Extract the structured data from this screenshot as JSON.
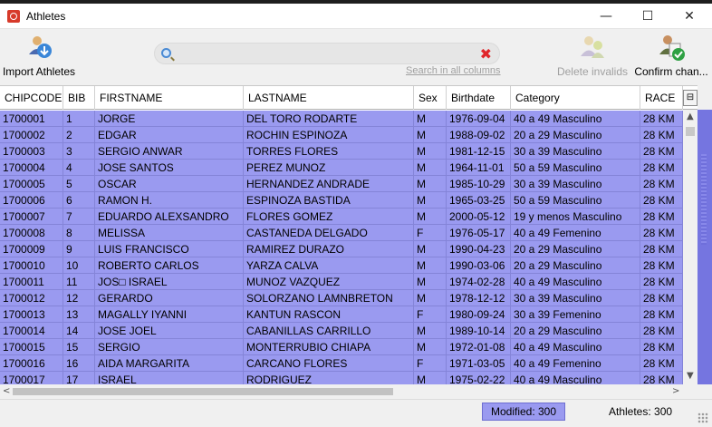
{
  "window": {
    "title": "Athletes",
    "minimize_glyph": "—",
    "maximize_glyph": "☐",
    "close_glyph": "✕"
  },
  "toolbar": {
    "import_label": "Import Athletes",
    "import_icon": "import-athletes-icon",
    "delete_invalids_label": "Delete invalids",
    "delete_invalids_icon": "delete-invalids-icon",
    "confirm_label": "Confirm chan...",
    "confirm_icon": "confirm-changes-icon"
  },
  "search": {
    "value": "",
    "search_icon": "search-icon",
    "clear_icon": "clear-icon",
    "clear_glyph": "✖",
    "scope_link": "Search in all columns"
  },
  "table": {
    "columns": [
      "CHIPCODE",
      "BIB",
      "FIRSTNAME",
      "LASTNAME",
      "Sex",
      "Birthdate",
      "Category",
      "RACE"
    ],
    "corner_glyph": "⊟",
    "rows": [
      [
        "1700001",
        "1",
        "JORGE",
        "DEL TORO RODARTE",
        "M",
        "1976-09-04",
        "40 a 49  Masculino",
        "28 KM"
      ],
      [
        "1700002",
        "2",
        "EDGAR",
        "ROCHIN ESPINOZA",
        "M",
        "1988-09-02",
        "20 a 29  Masculino",
        "28 KM"
      ],
      [
        "1700003",
        "3",
        "SERGIO ANWAR",
        "TORRES FLORES",
        "M",
        "1981-12-15",
        "30 a 39  Masculino",
        "28 KM"
      ],
      [
        "1700004",
        "4",
        "JOSE SANTOS",
        "PEREZ MUNOZ",
        "M",
        "1964-11-01",
        "50 a 59  Masculino",
        "28 KM"
      ],
      [
        "1700005",
        "5",
        "OSCAR",
        "HERNANDEZ ANDRADE",
        "M",
        "1985-10-29",
        "30 a 39  Masculino",
        "28 KM"
      ],
      [
        "1700006",
        "6",
        "RAMON H.",
        "ESPINOZA BASTIDA",
        "M",
        "1965-03-25",
        "50 a 59  Masculino",
        "28 KM"
      ],
      [
        "1700007",
        "7",
        "EDUARDO ALEXSANDRO",
        "FLORES GOMEZ",
        "M",
        "2000-05-12",
        "19  y menos Masculino",
        "28 KM"
      ],
      [
        "1700008",
        "8",
        "MELISSA",
        "CASTANEDA DELGADO",
        "F",
        "1976-05-17",
        "40 a 49  Femenino",
        "28 KM"
      ],
      [
        "1700009",
        "9",
        "LUIS FRANCISCO",
        "RAMIREZ DURAZO",
        "M",
        "1990-04-23",
        "20 a 29  Masculino",
        "28 KM"
      ],
      [
        "1700010",
        "10",
        "ROBERTO CARLOS",
        "YARZA CALVA",
        "M",
        "1990-03-06",
        "20 a 29  Masculino",
        "28 KM"
      ],
      [
        "1700011",
        "11",
        "JOS□ ISRAEL",
        "MUNOZ VAZQUEZ",
        "M",
        "1974-02-28",
        "40 a 49  Masculino",
        "28 KM"
      ],
      [
        "1700012",
        "12",
        "GERARDO",
        "SOLORZANO LAMNBRETON",
        "M",
        "1978-12-12",
        "30 a 39  Masculino",
        "28 KM"
      ],
      [
        "1700013",
        "13",
        "MAGALLY IYANNI",
        "KANTUN RASCON",
        "F",
        "1980-09-24",
        "30 a 39  Femenino",
        "28 KM"
      ],
      [
        "1700014",
        "14",
        "JOSE JOEL",
        "CABANILLAS CARRILLO",
        "M",
        "1989-10-14",
        "20 a 29  Masculino",
        "28 KM"
      ],
      [
        "1700015",
        "15",
        "SERGIO",
        "MONTERRUBIO CHIAPA",
        "M",
        "1972-01-08",
        "40 a 49  Masculino",
        "28 KM"
      ],
      [
        "1700016",
        "16",
        "AIDA MARGARITA",
        "CARCANO FLORES",
        "F",
        "1971-03-05",
        "40 a 49  Femenino",
        "28 KM"
      ],
      [
        "1700017",
        "17",
        "ISRAEL",
        "RODRIGUEZ",
        "M",
        "1975-02-22",
        "40 a 49  Masculino",
        "28 KM"
      ]
    ]
  },
  "scrollbars": {
    "up_glyph": "▲",
    "down_glyph": "▼",
    "left_glyph": "<",
    "right_glyph": ">"
  },
  "status": {
    "modified": "Modified: 300",
    "athletes": "Athletes: 300"
  },
  "colors": {
    "row_highlight": "#9a9af0",
    "app_icon": "#d73a2a",
    "clear_icon": "#e0262a"
  }
}
